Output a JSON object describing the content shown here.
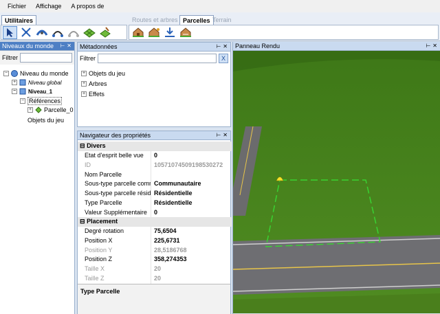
{
  "menu": {
    "items": [
      "Fichier",
      "Affichage",
      "A propos de"
    ]
  },
  "ribbon": {
    "tabs": [
      {
        "label": "Utilitaires"
      },
      {
        "label": "Routes et arbres"
      },
      {
        "label": "Parcelles"
      },
      {
        "label": "Terrain"
      }
    ],
    "left_tools": [
      "cursor-select-icon",
      "spread-arrows-icon",
      "path-tool-icon",
      "curve-edit-icon",
      "curve-delete-icon",
      "grid-paint-icon",
      "terrain-brush-icon"
    ],
    "right_tools": [
      "house-add-icon",
      "house-edit-icon",
      "download-arrow-icon",
      "house-move-icon"
    ]
  },
  "world_panel": {
    "title": "Niveaux du monde",
    "filter_label": "Filtrer",
    "filter_value": "",
    "tree": {
      "root": "Niveau du monde",
      "global": "Niveau global",
      "level": "Niveau_1",
      "refs": "Références",
      "parcel": "Parcelle_0",
      "objects": "Objets du jeu"
    }
  },
  "metadata_panel": {
    "title": "Métadonnées",
    "filter_label": "Filtrer",
    "filter_value": "",
    "clear": "X",
    "items": [
      "Objets du jeu",
      "Arbres",
      "Effets"
    ]
  },
  "props_panel": {
    "title": "Navigateur des propriétés",
    "cat1": "Divers",
    "rows1": [
      {
        "k": "Etat d'esprit belle vue",
        "v": "0",
        "dim": false
      },
      {
        "k": "ID",
        "v": "10571074509198530272",
        "dim": true
      },
      {
        "k": "Nom Parcelle",
        "v": "",
        "dim": false
      },
      {
        "k": "Sous-type parcelle comm",
        "v": "Communautaire",
        "dim": false
      },
      {
        "k": "Sous-type parcelle résid",
        "v": "Résidentielle",
        "dim": false
      },
      {
        "k": "Type Parcelle",
        "v": "Résidentielle",
        "dim": false
      },
      {
        "k": "Valeur Supplémentaire",
        "v": "0",
        "dim": false
      }
    ],
    "cat2": "Placement",
    "rows2": [
      {
        "k": "Degré rotation",
        "v": "75,6504",
        "dim": false
      },
      {
        "k": "Position X",
        "v": "225,6731",
        "dim": false
      },
      {
        "k": "Position Y",
        "v": "28,5186768",
        "dim": true
      },
      {
        "k": "Position Z",
        "v": "358,274353",
        "dim": false
      },
      {
        "k": "Taille X",
        "v": "20",
        "dim": true
      },
      {
        "k": "Taille Z",
        "v": "20",
        "dim": true
      }
    ],
    "description": "Type Parcelle"
  },
  "render_panel": {
    "title": "Panneau Rendu"
  },
  "colors": {
    "grass": "#4a7f1c",
    "road": "#6e6e72",
    "lot_outline": "#39d232",
    "accent": "#4d7fc4"
  }
}
